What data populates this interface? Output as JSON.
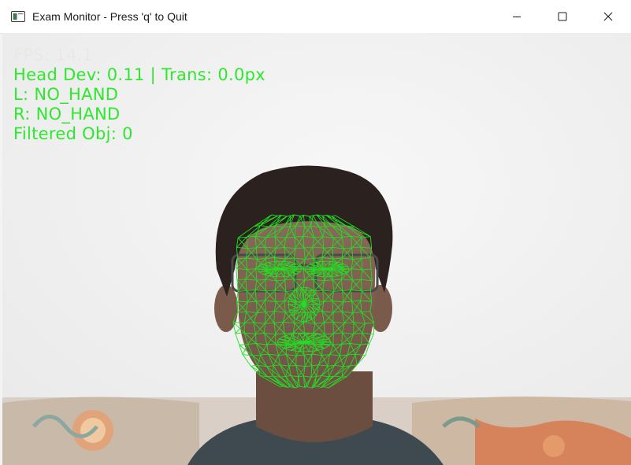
{
  "window": {
    "title": "Exam Monitor - Press 'q' to Quit",
    "icon": "app-window-icon",
    "controls": {
      "minimize_icon": "minimize-icon",
      "maximize_icon": "maximize-icon",
      "close_icon": "close-icon"
    }
  },
  "overlay": {
    "fps": "FPS: 14.1",
    "head_dev": "Head Dev: 0.11 | Trans: 0.0px",
    "left_hand": "L: NO_HAND",
    "right_hand": "R: NO_HAND",
    "filtered_obj": "Filtered Obj: 0"
  },
  "colors": {
    "overlay_text": "#2ee82e",
    "fps_text": "#e8e8e8",
    "face_mesh": "#22dd22",
    "background": "#f1f1f1"
  }
}
